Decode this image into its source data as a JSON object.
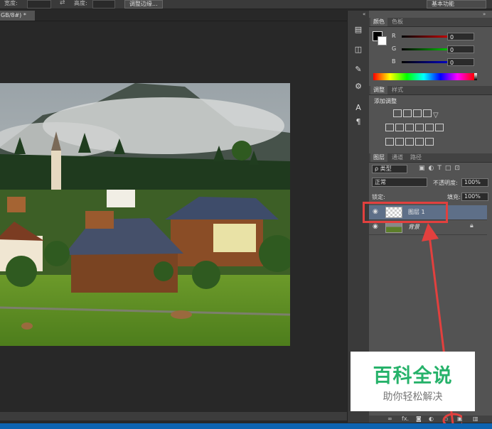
{
  "options_bar": {
    "width_label": "宽度:",
    "height_label": "高度:",
    "refine_edge_button": "调整边缘...",
    "workspace": "基本功能"
  },
  "document": {
    "tab_title": "GB/8#) *",
    "close_glyph": "×"
  },
  "color_panel": {
    "tabs": [
      "颜色",
      "色板"
    ],
    "channels": [
      {
        "label": "R",
        "value": "0"
      },
      {
        "label": "G",
        "value": "0"
      },
      {
        "label": "B",
        "value": "0"
      }
    ]
  },
  "adjust_panel": {
    "tabs": [
      "调整",
      "样式"
    ],
    "heading": "添加调整"
  },
  "layers_panel": {
    "tabs": [
      "图层",
      "通道",
      "路径"
    ],
    "filter_kind": "ρ 类型",
    "blend_mode": "正常",
    "opacity_label": "不透明度:",
    "opacity_value": "100%",
    "lock_label": "锁定:",
    "fill_label": "填充:",
    "fill_value": "100%",
    "layers": [
      {
        "name": "图层 1",
        "selected": true
      },
      {
        "name": "背景",
        "selected": false
      }
    ],
    "bottom_icons": [
      "link-icon",
      "fx-icon",
      "mask-icon",
      "adjustment-icon",
      "folder-icon",
      "new-layer-icon",
      "trash-icon"
    ],
    "fx_label": "fx."
  },
  "watermark": {
    "title": "百科全说",
    "subtitle": "助你轻松解决"
  },
  "colors": {
    "annotation_red": "#e2403e",
    "watermark_green": "#26b26a",
    "panel_bg": "#535353",
    "canvas_bg": "#282828"
  }
}
